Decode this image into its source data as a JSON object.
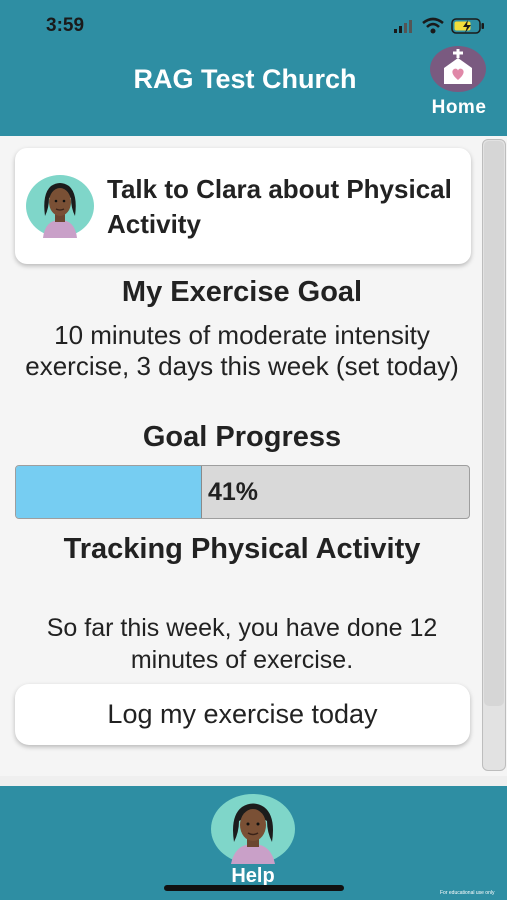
{
  "status_bar": {
    "time": "3:59"
  },
  "header": {
    "title": "RAG Test Church",
    "home_label": "Home"
  },
  "talk_card": {
    "label": "Talk to Clara about Physical Activity"
  },
  "goal": {
    "heading": "My Exercise Goal",
    "description": "10 minutes of moderate intensity exercise, 3 days this week (set today)"
  },
  "progress": {
    "heading": "Goal Progress",
    "label": "41%",
    "value": 0.41
  },
  "tracking": {
    "heading": "Tracking Physical Activity",
    "summary": "So far this week, you have done 12 minutes of exercise."
  },
  "log_button": {
    "label": "Log my exercise today"
  },
  "bottom": {
    "help_label": "Help",
    "fine_print": "For educational use only"
  },
  "colors": {
    "header": "#2e8ea3",
    "progress_fill": "#76cdf2",
    "home_icon": "#7a5a80"
  }
}
